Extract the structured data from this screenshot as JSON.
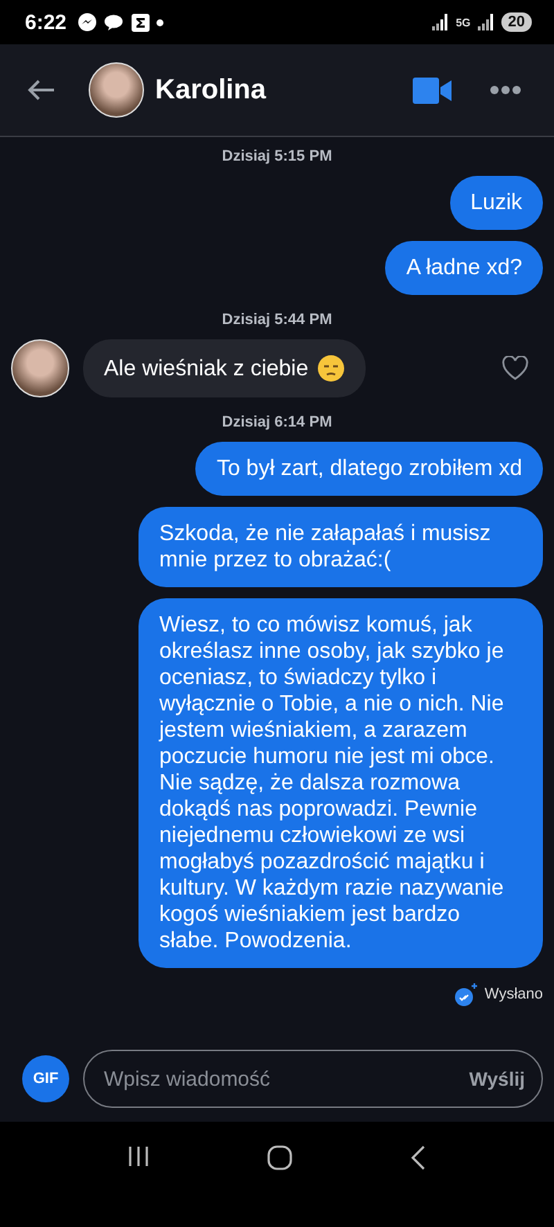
{
  "status_bar": {
    "time": "6:22",
    "network_type": "5G",
    "battery": "20"
  },
  "header": {
    "contact_name": "Karolina"
  },
  "messages": [
    {
      "kind": "timestamp",
      "text": "Dzisiaj 5:15 PM"
    },
    {
      "kind": "sent",
      "text": "Luzik"
    },
    {
      "kind": "sent",
      "text": "A ładne xd?"
    },
    {
      "kind": "timestamp",
      "text": "Dzisiaj 5:44 PM"
    },
    {
      "kind": "received",
      "text": "Ale wieśniak z ciebie",
      "liked": false
    },
    {
      "kind": "timestamp",
      "text": "Dzisiaj 6:14 PM"
    },
    {
      "kind": "sent",
      "text": "To był zart, dlatego zrobiłem xd"
    },
    {
      "kind": "sent",
      "text": "Szkoda, że nie załapałaś i musisz mnie przez to obrażać:("
    },
    {
      "kind": "sent",
      "text": "Wiesz, to co mówisz komuś, jak określasz inne osoby, jak szybko je oceniasz, to świadczy tylko i wyłącznie o Tobie, a nie o nich. Nie jestem wieśniakiem, a zarazem poczucie humoru nie jest mi obce. Nie sądzę, że dalsza rozmowa dokądś nas poprowadzi. Pewnie niejednemu człowiekowi ze wsi mogłabyś pozazdrościć majątku i kultury. W każdym razie nazywanie kogoś wieśniakiem jest bardzo słabe. Powodzenia."
    }
  ],
  "delivery_status": "Wysłano",
  "composer": {
    "gif_label": "GIF",
    "placeholder": "Wpisz wiadomość",
    "send_label": "Wyślij"
  }
}
